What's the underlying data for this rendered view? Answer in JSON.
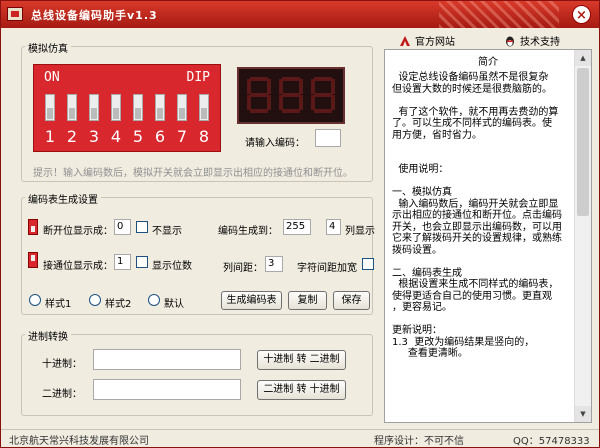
{
  "window": {
    "title": "总线设备编码助手v1.3",
    "close_glyph": "×"
  },
  "sim": {
    "group_title": "模拟仿真",
    "dip_on": "ON",
    "dip_dip": "DIP",
    "dip_numbers": [
      "1",
      "2",
      "3",
      "4",
      "5",
      "6",
      "7",
      "8"
    ],
    "input_label": "请输入编码：",
    "input_value": "",
    "tip": "提示！输入编码数后，模拟开关就会立即显示出相应的接通位和断开位。"
  },
  "table": {
    "group_title": "编码表生成设置",
    "off_label": "断开位显示成：",
    "off_value": "0",
    "off_hide_label": "不显示",
    "on_label": "接通位显示成：",
    "on_value": "1",
    "show_bits_label": "显示位数",
    "gen_to_label": "编码生成到：",
    "gen_to_value": "255",
    "cols_value": "4",
    "cols_label": "列显示",
    "col_gap_label": "列间距：",
    "col_gap_value": "3",
    "char_gap_label": "字符间距加宽",
    "style1": "样式1",
    "style2": "样式2",
    "default": "默认",
    "btn_generate": "生成编码表",
    "btn_copy": "复制",
    "btn_save": "保存"
  },
  "convert": {
    "group_title": "进制转换",
    "dec_label": "十进制：",
    "dec_value": "",
    "bin_label": "二进制：",
    "bin_value": "",
    "btn_dec2bin": "十进制 转 二进制",
    "btn_bin2dec": "二进制 转 十进制"
  },
  "links": {
    "official": "官方网站",
    "support": "技术支持"
  },
  "intro": {
    "title": "简介",
    "text": "  设定总线设备编码虽然不是很复杂\n但设置大数的时候还是很费脑筋的。\n\n  有了这个软件，就不用再去费劲的算\n了。可以生成不同样式的编码表。使\n用方便，省时省力。\n\n\n  使用说明：\n\n一、模拟仿真\n  输入编码数后，编码开关就会立即显\n示出相应的接通位和断开位。点击编码\n开关，也会立即显示出编码数，可以用\n它来了解拨码开关的设置规律，或熟练\n拨码设置。\n\n二、编码表生成\n  根据设置来生成不同样式的编码表，\n使得更适合自己的使用习惯。更直观\n，更容易记。\n\n更新说明：\n1.3  更改为编码结果是竖向的，\n     查看更清晰。"
  },
  "status": {
    "company": "北京航天常兴科技发展有限公司",
    "designer": "程序设计：不可不信",
    "qq": "QQ：57478333"
  },
  "colors": {
    "title_bar": "#c0281c",
    "dip_red": "#d8272d",
    "seg_bg": "#221010"
  }
}
